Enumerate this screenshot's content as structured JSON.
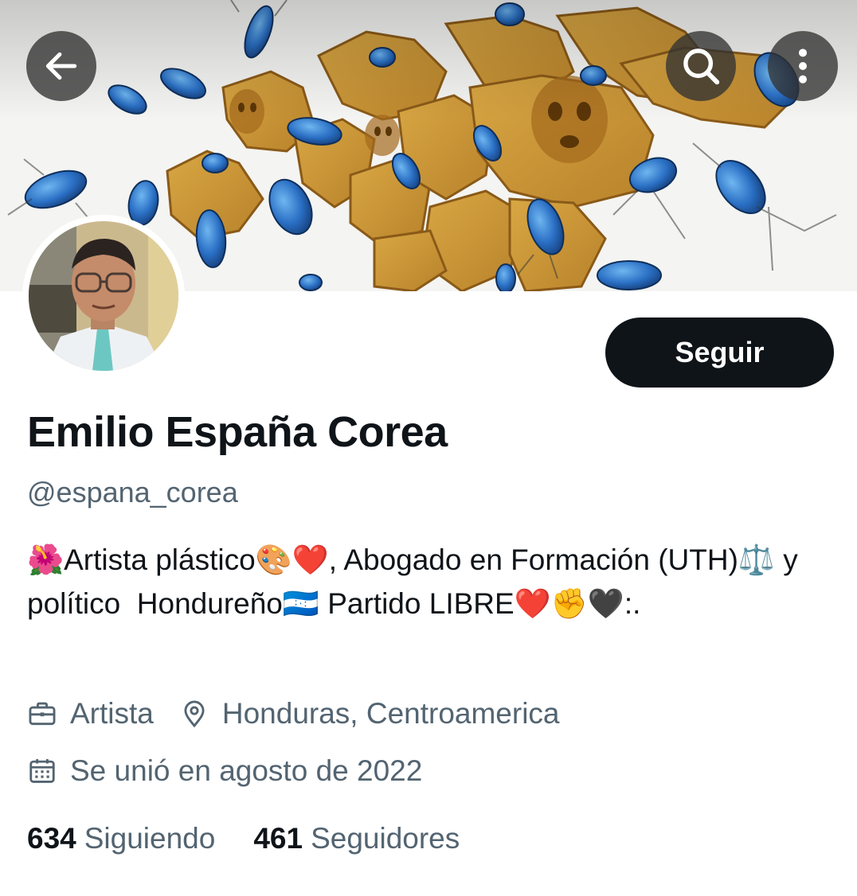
{
  "profile": {
    "display_name": "Emilio España Corea",
    "handle": "@espana_corea",
    "bio": "🌺Artista plástico🎨❤️, Abogado en Formación (UTH)⚖️ y político  Hondureño🇭🇳 Partido LIBRE❤️✊🖤:.",
    "category": "Artista",
    "location": "Honduras, Centroamerica",
    "joined": "Se unió en agosto de 2022"
  },
  "actions": {
    "follow_label": "Seguir"
  },
  "stats": {
    "following_count": "634",
    "following_label": "Siguiendo",
    "followers_count": "461",
    "followers_label": "Seguidores"
  },
  "icons": {
    "back": "arrow-left-icon",
    "search": "search-icon",
    "more": "more-vertical-icon",
    "category": "briefcase-icon",
    "location": "location-pin-icon",
    "joined": "calendar-icon"
  },
  "colors": {
    "text_primary": "#0f1419",
    "text_secondary": "#536471",
    "button_dark": "#0f1419"
  }
}
